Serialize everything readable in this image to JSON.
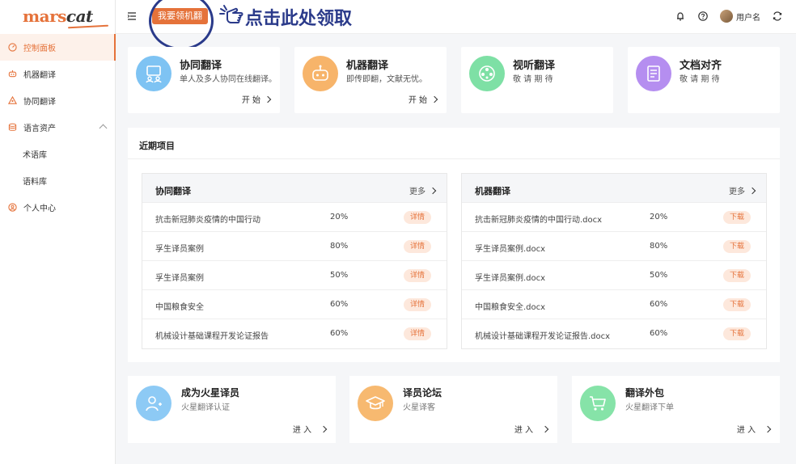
{
  "brand": {
    "logo_a": "mars",
    "logo_b": "cat",
    "accent": "#e5723a",
    "annotation_color": "#2a3a8a"
  },
  "sidebar": {
    "items": [
      {
        "label": "控制面板",
        "icon": "dashboard-icon"
      },
      {
        "label": "机器翻译",
        "icon": "robot-icon"
      },
      {
        "label": "协同翻译",
        "icon": "people-icon"
      },
      {
        "label": "语言资产",
        "icon": "database-icon"
      },
      {
        "label": "术语库"
      },
      {
        "label": "语料库"
      },
      {
        "label": "个人中心",
        "icon": "user-circle-icon"
      }
    ]
  },
  "header": {
    "promo_button": "我要领机翻",
    "annotation": "点击此处领取",
    "username": "用户名"
  },
  "top_cards": [
    {
      "title": "协同翻译",
      "desc": "单人及多人协同在线翻译。",
      "action": "开 始",
      "color": "#7ec3f3"
    },
    {
      "title": "机器翻译",
      "desc": "即传即翻，文献无忧。",
      "action": "开 始",
      "color": "#f7b46a"
    },
    {
      "title": "视听翻译",
      "desc": "敬 请 期 待",
      "color": "#7ee0a5"
    },
    {
      "title": "文档对齐",
      "desc": "敬 请 期 待",
      "color": "#b58ef0"
    }
  ],
  "recent": {
    "title": "近期项目",
    "collab": {
      "title": "协同翻译",
      "more": "更多",
      "rows": [
        {
          "name": "抗击新冠肺炎疫情的中国行动",
          "progress": "20%",
          "btn": "详情"
        },
        {
          "name": "孚生译员案例",
          "progress": "80%",
          "btn": "详情"
        },
        {
          "name": "孚生译员案例",
          "progress": "50%",
          "btn": "详情"
        },
        {
          "name": "中国粮食安全",
          "progress": "60%",
          "btn": "详情"
        },
        {
          "name": "机械设计基础课程开发论证报告",
          "progress": "60%",
          "btn": "详情"
        }
      ]
    },
    "machine": {
      "title": "机器翻译",
      "more": "更多",
      "rows": [
        {
          "name": "抗击新冠肺炎疫情的中国行动.docx",
          "progress": "20%",
          "btn": "下载"
        },
        {
          "name": "孚生译员案例.docx",
          "progress": "80%",
          "btn": "下载"
        },
        {
          "name": "孚生译员案例.docx",
          "progress": "50%",
          "btn": "下载"
        },
        {
          "name": "中国粮食安全.docx",
          "progress": "60%",
          "btn": "下载"
        },
        {
          "name": "机械设计基础课程开发论证报告.docx",
          "progress": "60%",
          "btn": "下载"
        }
      ]
    }
  },
  "bottom_cards": [
    {
      "title": "成为火星译员",
      "desc": "火星翻译认证",
      "action": "进 入",
      "color": "#8dcaf5"
    },
    {
      "title": "译员论坛",
      "desc": "火星译客",
      "action": "进 入",
      "color": "#f7b970"
    },
    {
      "title": "翻译外包",
      "desc": "火星翻译下单",
      "action": "进 入",
      "color": "#86e3a8"
    }
  ]
}
